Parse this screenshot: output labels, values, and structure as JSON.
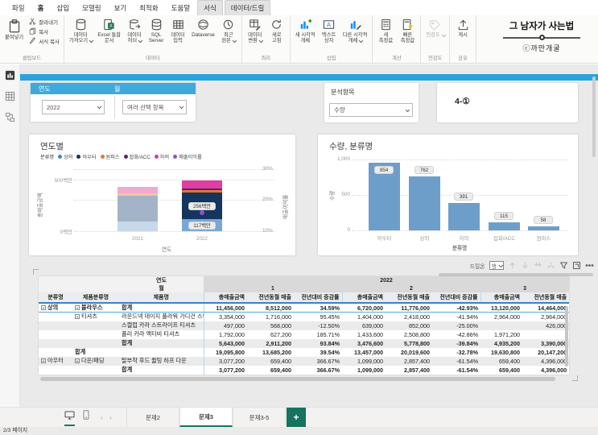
{
  "app": {
    "menu_tabs": [
      "파일",
      "홈",
      "삽입",
      "모델링",
      "보기",
      "최적화",
      "도움말",
      "서식",
      "데이터/드릴"
    ],
    "active_tab": "홈",
    "contextual_tabs": [
      "서식",
      "데이터/드릴"
    ],
    "branding_title": "그 남자가 사는법",
    "branding_credit": "ⓒ까만개굴",
    "status": "2/3 페이지"
  },
  "ribbon": {
    "groups": [
      {
        "label": "클립보드",
        "items": [
          {
            "label": "붙여넣기",
            "icon": "paste",
            "big": true
          },
          {
            "label": "잘라내기",
            "icon": "cut",
            "small": true
          },
          {
            "label": "복사",
            "icon": "copy",
            "small": true
          },
          {
            "label": "서식 복사",
            "icon": "brush",
            "small": true
          }
        ]
      },
      {
        "label": "데이터",
        "items": [
          {
            "label": "데이터\n가져오기",
            "icon": "getdata",
            "caret": true
          },
          {
            "label": "Excel 통합\n문서",
            "icon": "excel"
          },
          {
            "label": "데이터\n허브",
            "icon": "hub",
            "caret": true
          },
          {
            "label": "SQL\nServer",
            "icon": "sql"
          },
          {
            "label": "데이터\n입력",
            "icon": "enterdata"
          },
          {
            "label": "Dataverse",
            "icon": "dataverse"
          },
          {
            "label": "최근\n원본",
            "icon": "recent",
            "caret": true
          }
        ]
      },
      {
        "label": "쿼리",
        "items": [
          {
            "label": "데이터\n변환",
            "icon": "transform",
            "caret": true
          },
          {
            "label": "새로\n고침",
            "icon": "refresh"
          }
        ]
      },
      {
        "label": "삽입",
        "items": [
          {
            "label": "새 시각적\n개체",
            "icon": "newvisual"
          },
          {
            "label": "텍스트\n상자",
            "icon": "textbox"
          },
          {
            "label": "다른 시각적\n개체",
            "icon": "othervisual",
            "caret": true
          }
        ]
      },
      {
        "label": "계산",
        "items": [
          {
            "label": "새\n측정값",
            "icon": "measure"
          },
          {
            "label": "빠른\n측정값",
            "icon": "quickmeasure"
          }
        ]
      },
      {
        "label": "민감도",
        "items": [
          {
            "label": "민감도",
            "icon": "sensitivity",
            "caret": true,
            "disabled": true
          }
        ]
      },
      {
        "label": "공유",
        "items": [
          {
            "label": "게시",
            "icon": "publish"
          }
        ]
      }
    ]
  },
  "slicers": {
    "year": {
      "title": "연도",
      "value": "2022"
    },
    "month": {
      "title": "월",
      "value": "여러 선택 항목"
    },
    "analysis": {
      "title": "분석항목",
      "value": "수량"
    }
  },
  "label_card": {
    "text": "4-①"
  },
  "chart_data": [
    {
      "type": "stacked-column-line",
      "title": "연도별",
      "legend_title": "분류명",
      "categories": [
        "2021",
        "2022"
      ],
      "series": [
        {
          "name": "상의",
          "color": "#3c8ad0",
          "faded": "#c7d8ea",
          "strong": "#7aa6d6",
          "values": [
            95,
            117
          ],
          "label_2022": "117백만"
        },
        {
          "name": "아우터",
          "color": "#13355e",
          "faded": "#a3b4c9",
          "strong": "#13355e",
          "values": [
            250,
            256
          ],
          "label_2022": "256백만"
        },
        {
          "name": "원피스",
          "color": "#e8742a",
          "faded": "#f3c6a5",
          "strong": "#e8742a",
          "values": [
            25,
            23
          ]
        },
        {
          "name": "잡화/ACC",
          "color": "#5c2466",
          "faded": "#c9b8ce",
          "strong": "#5c2466",
          "values": [
            0,
            18
          ]
        },
        {
          "name": "하의",
          "color": "#e0399f",
          "faded": "#f0a9cf",
          "strong": "#de3fa4",
          "values": [
            60,
            78
          ]
        }
      ],
      "line_series": {
        "name": "매출이익률",
        "color": "#8f4fc8",
        "values_pct": [
          null,
          16
        ]
      },
      "xlabel": "연도",
      "ylabel_left": "총매출금액",
      "yticks_left": [
        "0백만",
        "500백만"
      ],
      "ylabel_right": "매출이익률",
      "yticks_right": [
        "10%",
        "20%",
        "30%"
      ]
    },
    {
      "type": "bar",
      "title": "수량, 분류명",
      "categories": [
        "아우터",
        "상의",
        "하의",
        "잡화/ACC",
        "원피스"
      ],
      "values": [
        954,
        762,
        391,
        115,
        58
      ],
      "labels": [
        "954",
        "762",
        "391",
        "115",
        "58"
      ],
      "xlabel": "분류명",
      "ylabel": "수량",
      "yticks": [
        "0",
        "500",
        "1,000"
      ],
      "ylim": [
        0,
        1000
      ],
      "bar_color": "#6d9ec9"
    }
  ],
  "matrix": {
    "toolbar": {
      "drill_label": "드릴온",
      "drill_value": "행"
    },
    "corner_year": "연도",
    "corner_month": "월",
    "year_span": "2022",
    "month_groups": [
      "1",
      "2",
      "3"
    ],
    "value_headers": [
      "총매출금액",
      "전년동월 매출",
      "전년대비 증감률"
    ],
    "row_headers": [
      "분류명",
      "제품분류명",
      "제품명"
    ],
    "rows": [
      {
        "cat": "상의",
        "catExp": true,
        "sub": "블라우스",
        "subExp": true,
        "prod": "합계",
        "bold": true,
        "top": true,
        "vals": [
          "11,456,000",
          "8,512,000",
          "34.59%",
          "6,720,000",
          "11,776,000",
          "-42.93%",
          "13,120,000",
          "14,464,000"
        ]
      },
      {
        "cat": "",
        "sub": "티셔츠",
        "subExp": true,
        "prod": "라운드넥 데이지 플라워 가디건 스웨터",
        "vals": [
          "3,354,000",
          "1,716,000",
          "95.45%",
          "1,404,000",
          "2,418,000",
          "-41.94%",
          "2,964,000",
          "2,964,000"
        ]
      },
      {
        "cat": "",
        "sub": "",
        "prod": "스캘럽 카라 스트라이프 티셔츠",
        "band": true,
        "vals": [
          "497,000",
          "568,000",
          "-12.50%",
          "639,000",
          "852,000",
          "-25.00%",
          "",
          "426,000"
        ]
      },
      {
        "cat": "",
        "sub": "",
        "prod": "폴리 카라 액티비 티셔츠",
        "vals": [
          "1,792,000",
          "627,200",
          "185.71%",
          "1,433,600",
          "2,508,800",
          "-42.86%",
          "1,971,200",
          ""
        ]
      },
      {
        "cat": "",
        "sub": "",
        "prod": "합계",
        "bold": true,
        "band": true,
        "vals": [
          "5,643,000",
          "2,911,200",
          "93.84%",
          "3,476,600",
          "5,778,800",
          "-39.84%",
          "4,935,200",
          "3,390,000"
        ]
      },
      {
        "cat": "",
        "sub": "합계",
        "prod": "",
        "bold": true,
        "vals": [
          "19,095,800",
          "13,685,200",
          "39.54%",
          "13,457,000",
          "20,019,600",
          "-32.78%",
          "19,630,800",
          "20,147,200"
        ]
      },
      {
        "cat": "아우터",
        "catExp": true,
        "sub": "다운/패딩",
        "subExp": true,
        "prod": "탈부착 후드 퀼팅 하프 다운",
        "band": true,
        "vals": [
          "3,077,200",
          "659,400",
          "366.67%",
          "1,099,000",
          "2,857,400",
          "-61.54%",
          "659,400",
          "4,396,000"
        ]
      },
      {
        "cat": "",
        "sub": "",
        "prod": "합계",
        "bold": true,
        "vals": [
          "3,077,200",
          "659,400",
          "366.67%",
          "1,099,000",
          "2,857,400",
          "-61.54%",
          "659,400",
          "4,396,000"
        ]
      }
    ]
  },
  "pages": {
    "tabs": [
      "문제2",
      "문제3",
      "문제3-5"
    ],
    "active": "문제3",
    "add_label": "+"
  }
}
